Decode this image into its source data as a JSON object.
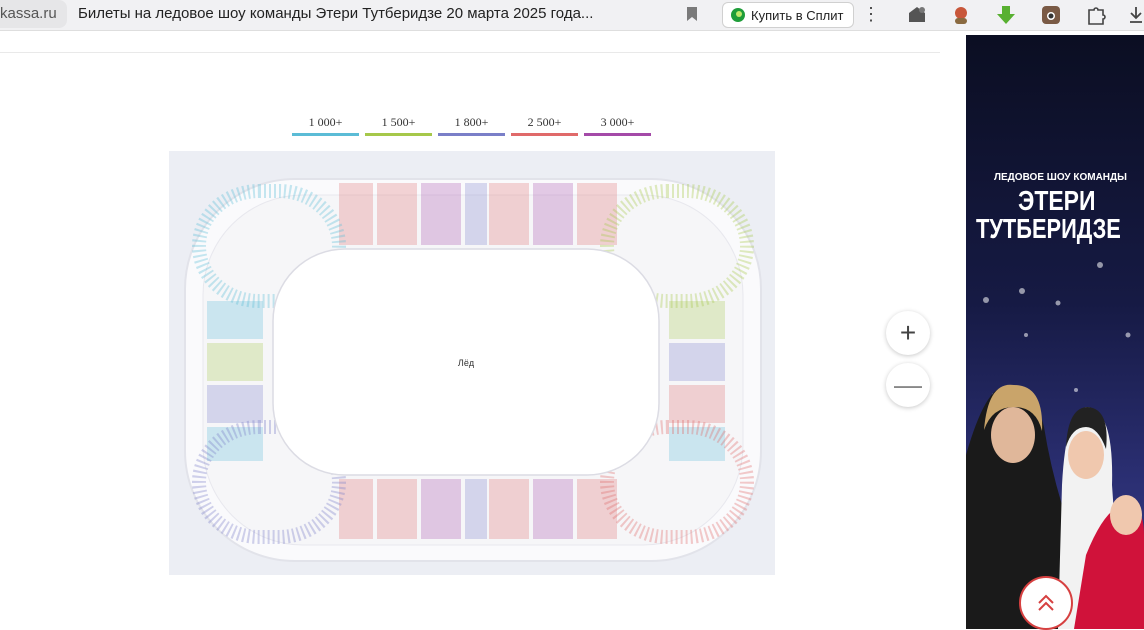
{
  "browser": {
    "domain": "kassa.ru",
    "page_title": "Билеты на ледовое шоу команды Этери Тутберидзе 20 марта 2025 года...",
    "split_button_label": "Купить в Сплит",
    "icons": [
      "bookmark-icon",
      "kebab-menu-icon",
      "adblock-icon",
      "avatar-extension-icon",
      "download-arrow-icon",
      "instagram-icon",
      "puzzle-extension-icon",
      "download-icon"
    ]
  },
  "price_legend": [
    {
      "label": "1 000+",
      "color": "#5bbcd6"
    },
    {
      "label": "1 500+",
      "color": "#a6c84a"
    },
    {
      "label": "1 800+",
      "color": "#7a7fc8"
    },
    {
      "label": "2 500+",
      "color": "#e06a6a"
    },
    {
      "label": "3 000+",
      "color": "#a44aa8"
    }
  ],
  "seat_map": {
    "ice_label": "Лёд",
    "background": "#eceef4"
  },
  "zoom": {
    "plus_symbol": "+",
    "minus_symbol": "—"
  },
  "ad": {
    "subtitle": "ЛЕДОВОЕ ШОУ КОМАНДЫ",
    "title_line1": "ЭТЕРИ",
    "title_line2": "ТУТБЕРИДЗЕ"
  }
}
